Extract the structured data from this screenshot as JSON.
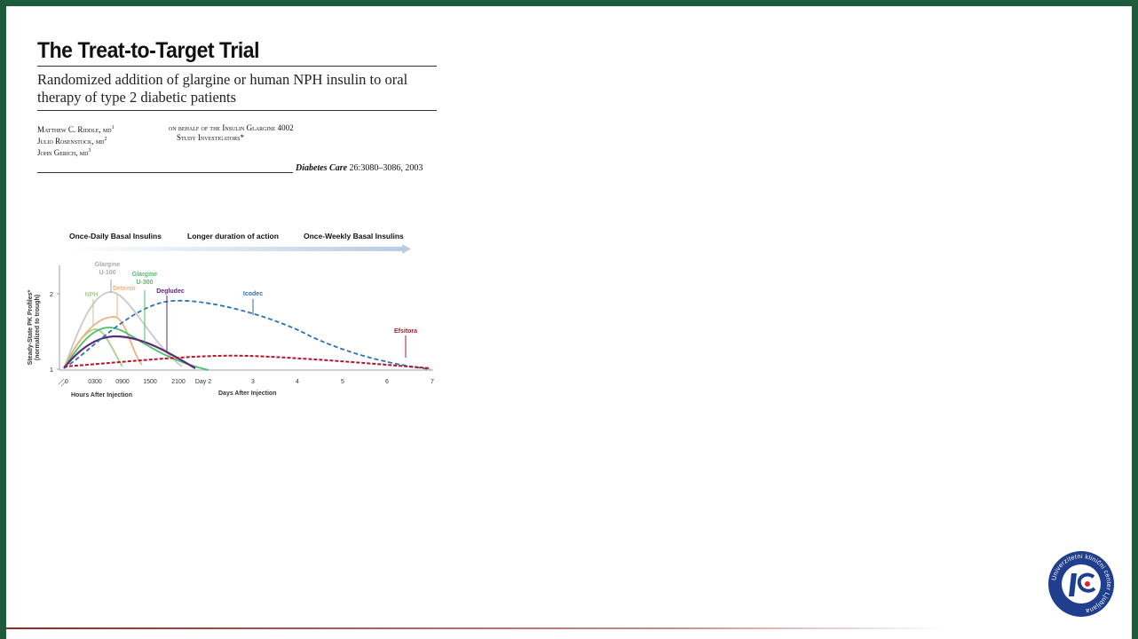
{
  "article": {
    "title": "The Treat-to-Target Trial",
    "subtitle": "Randomized addition of glargine or human NPH insulin to oral therapy of type 2 diabetic patients",
    "authors": [
      "Matthew C. Riddle, md",
      "Julio Rosenstock, md",
      "John Gerich, md"
    ],
    "author_superscripts": [
      "1",
      "2",
      "3"
    ],
    "on_behalf_line1": "on behalf of the Insulin Glargine 4002",
    "on_behalf_line2": "Study Investigators*",
    "journal": "Diabetes Care",
    "citation": "26:3080–3086, 2003"
  },
  "figure": {
    "arrow_labels": [
      "Once-Daily Basal Insulins",
      "Longer duration of action",
      "Once-Weekly Basal Insulins"
    ],
    "ylabel_line1": "Steady-State PK Profiles*",
    "ylabel_line2": "(normalized to trough)",
    "y_ticks": [
      "2",
      "1"
    ],
    "hour_ticks": [
      "0",
      "0300",
      "0900",
      "1500",
      "2100"
    ],
    "day_ticks": [
      "Day 2",
      "3",
      "4",
      "5",
      "6",
      "7"
    ],
    "xlabel_hours": "Hours After Injection",
    "xlabel_days": "Days After Injection",
    "labels": {
      "glargine_u100_1": "Glargine",
      "glargine_u100_2": "U-100",
      "nph": "NPH",
      "detemir": "Detemir",
      "glargine_u300_1": "Glargine",
      "glargine_u300_2": "U-300",
      "degludec": "Degludec",
      "icodec": "Icodec",
      "efsitora": "Efsitora"
    },
    "colors": {
      "glargine_u100": "#c8c8c8",
      "nph": "#a6d08c",
      "detemir": "#f0b27a",
      "glargine_u300": "#4cbf6a",
      "degludec": "#5b2a7a",
      "icodec": "#2f6fb5",
      "efsitora": "#b0172e",
      "arrow": "#b8cce4"
    }
  },
  "logo": {
    "text_top": "Univerzitetni klinični center Ljubljana"
  }
}
